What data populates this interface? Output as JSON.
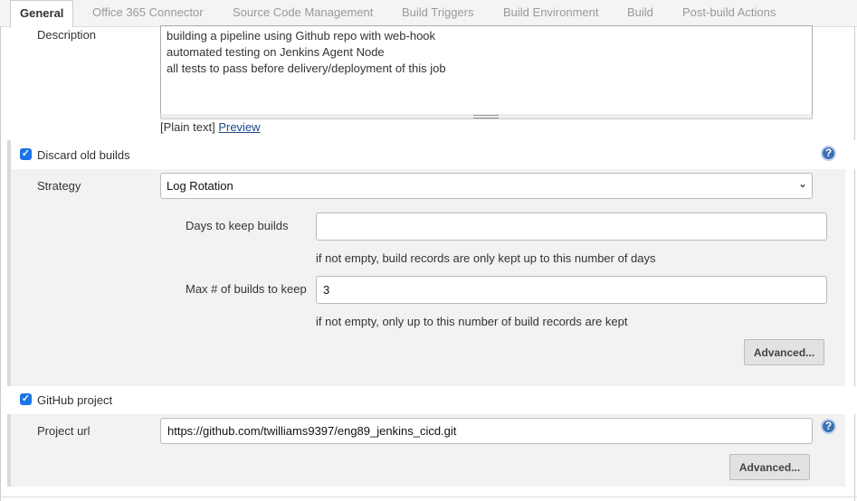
{
  "tabs": [
    {
      "label": "General",
      "active": true
    },
    {
      "label": "Office 365 Connector",
      "active": false
    },
    {
      "label": "Source Code Management",
      "active": false
    },
    {
      "label": "Build Triggers",
      "active": false
    },
    {
      "label": "Build Environment",
      "active": false
    },
    {
      "label": "Build",
      "active": false
    },
    {
      "label": "Post-build Actions",
      "active": false
    }
  ],
  "description": {
    "label": "Description",
    "value": "building a pipeline using Github repo with web-hook\nautomated testing on Jenkins Agent Node\nall tests to pass before delivery/deployment of this job",
    "plain_text": "[Plain text]",
    "preview_link": "Preview"
  },
  "discard_old_builds": {
    "checked": true,
    "label": "Discard old builds",
    "help_icon": "question-mark-help-icon",
    "strategy_label": "Strategy",
    "strategy_value": "Log Rotation",
    "days_label": "Days to keep builds",
    "days_value": "",
    "days_hint": "if not empty, build records are only kept up to this number of days",
    "max_label": "Max # of builds to keep",
    "max_value": "3",
    "max_hint": "if not empty, only up to this number of build records are kept",
    "advanced_button": "Advanced..."
  },
  "github_project": {
    "checked": true,
    "label": "GitHub project",
    "url_label": "Project url",
    "url_value": "https://github.com/twilliams9397/eng89_jenkins_cicd.git",
    "help_icon": "question-mark-help-icon",
    "advanced_button": "Advanced..."
  },
  "colors": {
    "accent": "#1a73e8",
    "link": "#204a87",
    "help_icon": "#3b6fb6",
    "section_bg": "#f2f2f2"
  }
}
